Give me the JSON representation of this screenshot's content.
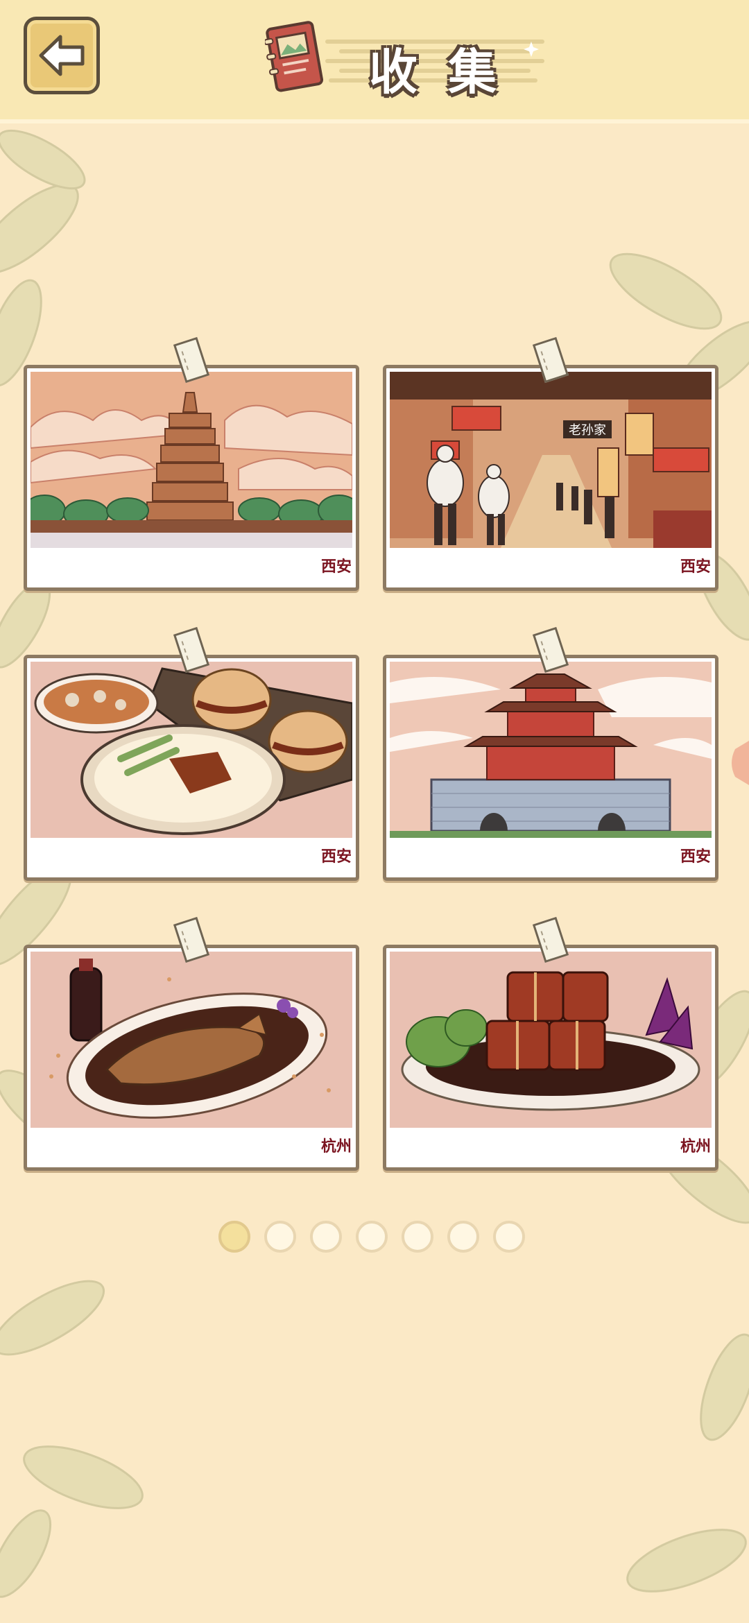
{
  "header": {
    "title": "收集"
  },
  "cards": [
    {
      "caption": "西安",
      "image": "big-wild-goose-pagoda"
    },
    {
      "caption": "西安",
      "image": "muslim-quarter-street",
      "sign": "老孙家"
    },
    {
      "caption": "西安",
      "image": "roujiamo-and-noodles"
    },
    {
      "caption": "西安",
      "image": "bell-tower"
    },
    {
      "caption": "杭州",
      "image": "west-lake-vinegar-fish"
    },
    {
      "caption": "杭州",
      "image": "dongpo-pork"
    }
  ],
  "pagination": {
    "total": 7,
    "current": 1
  },
  "colors": {
    "background": "#fbe9c6",
    "header": "#f9e8b4",
    "caption": "#7b1420",
    "frame": "#8d7a62"
  }
}
